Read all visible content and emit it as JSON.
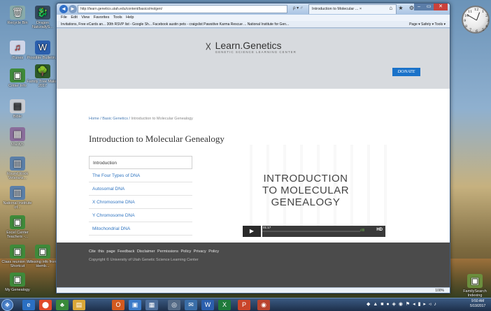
{
  "desktop": {
    "icons": [
      {
        "label": "Recycle Bin",
        "glyph": "🗑"
      },
      {
        "label": "Dragon NaturallyS...",
        "glyph": "🐉"
      },
      {
        "label": "iTunes",
        "glyph": "♫"
      },
      {
        "label": "Possible Bulletin...",
        "glyph": "W"
      },
      {
        "label": "Critter Info",
        "glyph": "▣"
      },
      {
        "label": "Family Tree Maker 2017",
        "glyph": "🌳"
      },
      {
        "label": "Bible",
        "glyph": "▤"
      },
      {
        "label": "Marilyn",
        "glyph": "▦"
      },
      {
        "label": "Round Rock Veterans...",
        "glyph": "▥"
      },
      {
        "label": "National Institute of...",
        "glyph": "▥"
      },
      {
        "label": "Excel Center Teachers -...",
        "glyph": "▣"
      },
      {
        "label": "Class reunion list - Shortcut",
        "glyph": "▣"
      },
      {
        "label": "Missing info from Hemb...",
        "glyph": "▣"
      },
      {
        "label": "My Genealogy",
        "glyph": "▣"
      },
      {
        "label": "FamilySearch Indexing",
        "glyph": "▣"
      }
    ],
    "clock": {
      "n12": "12",
      "n1": "1",
      "n2": "2",
      "n3": "3",
      "n4": "4",
      "n5": "5",
      "n6": "6",
      "n7": "7",
      "n8": "8",
      "n9": "9",
      "n10": "10",
      "n11": "11"
    }
  },
  "browser": {
    "url": "http://learn.genetics.utah.edu/content/basics/molgen/",
    "address_controls": "ρ ▾ ♂",
    "tab_title": "Introduction to Molecular ... ×",
    "toolbar_icons": "⌂ ★ ⚙",
    "window_controls": {
      "minimize": "–",
      "maximize": "▭",
      "close": "✕"
    },
    "menu": "File  Edit  View  Favorites  Tools  Help",
    "favorites": "Invitations, Free eCards an...   30th RSVP list - Google Sh...   Facebook   austin pets - craigslist   Pawsitive Karma Rescue ...   National Institute for Gen...",
    "command_bar": "Page ▾  Safety ▾  Tools ▾",
    "zoom": "100%"
  },
  "site": {
    "logo_mark": "☓",
    "logo_name": "Learn.Genetics",
    "logo_sub": "GENETIC SCIENCE LEARNING CENTER",
    "donate": "DONATE",
    "breadcrumb": {
      "home": "Home",
      "sep1": "/",
      "section": "Basic Genetics",
      "sep2": "/",
      "current": "Introduction to Molecular Genealogy"
    },
    "title": "Introduction to Molecular Genealogy",
    "nav": [
      "Introduction",
      "The Four Types of DNA",
      "Autosomal DNA",
      "X Chromosome DNA",
      "Y Chromosome DNA",
      "Mitochondrial DNA"
    ],
    "video": {
      "line1": "INTRODUCTION",
      "line2": "TO MOLECULAR",
      "line3": "GENEALOGY",
      "time": "01:17",
      "hd": "HD",
      "play": "▶",
      "volume": "ıllll"
    },
    "footer": {
      "links": "Cite this page   Feedback   Disclaimer   Permissions Policy   Privacy Policy",
      "copyright": "Copyright ©   University of Utah   Genetic Science Learning Center"
    }
  },
  "taskbar": {
    "start": "❖",
    "apps": [
      "e",
      "⬤",
      "♣",
      "▤",
      "O",
      "▣",
      "▦",
      "◎",
      "✉",
      "W",
      "X",
      "P",
      "◉"
    ],
    "time": "9:50 AM",
    "date": "5/19/2017"
  }
}
